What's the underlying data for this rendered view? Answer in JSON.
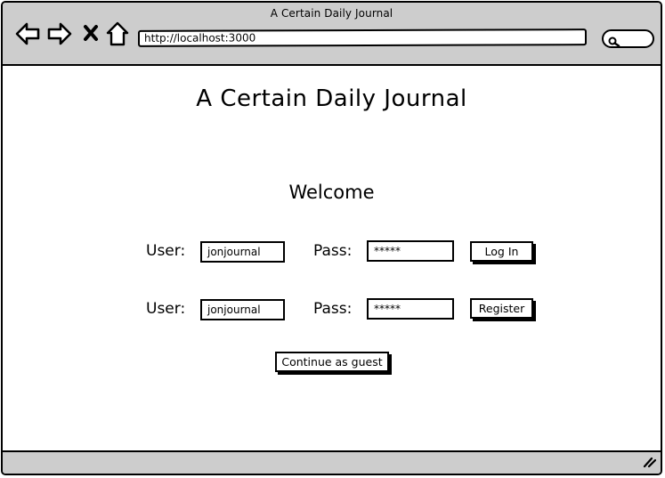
{
  "window": {
    "title": "A Certain Daily Journal"
  },
  "toolbar": {
    "url": "http://localhost:3000",
    "icons": [
      "back-arrow-icon",
      "forward-arrow-icon",
      "stop-icon",
      "home-icon",
      "search-icon"
    ]
  },
  "page": {
    "title": "A Certain Daily Journal",
    "welcome": "Welcome",
    "login": {
      "user_label": "User:",
      "user_value": "jonjournal",
      "pass_label": "Pass:",
      "pass_value": "*****",
      "button": "Log In"
    },
    "register": {
      "user_label": "User:",
      "user_value": "jonjournal",
      "pass_label": "Pass:",
      "pass_value": "*****",
      "button": "Register"
    },
    "guest_button": "Continue as guest"
  },
  "colors": {
    "chrome": "#cdcdcd",
    "border": "#000000",
    "background": "#ffffff"
  }
}
